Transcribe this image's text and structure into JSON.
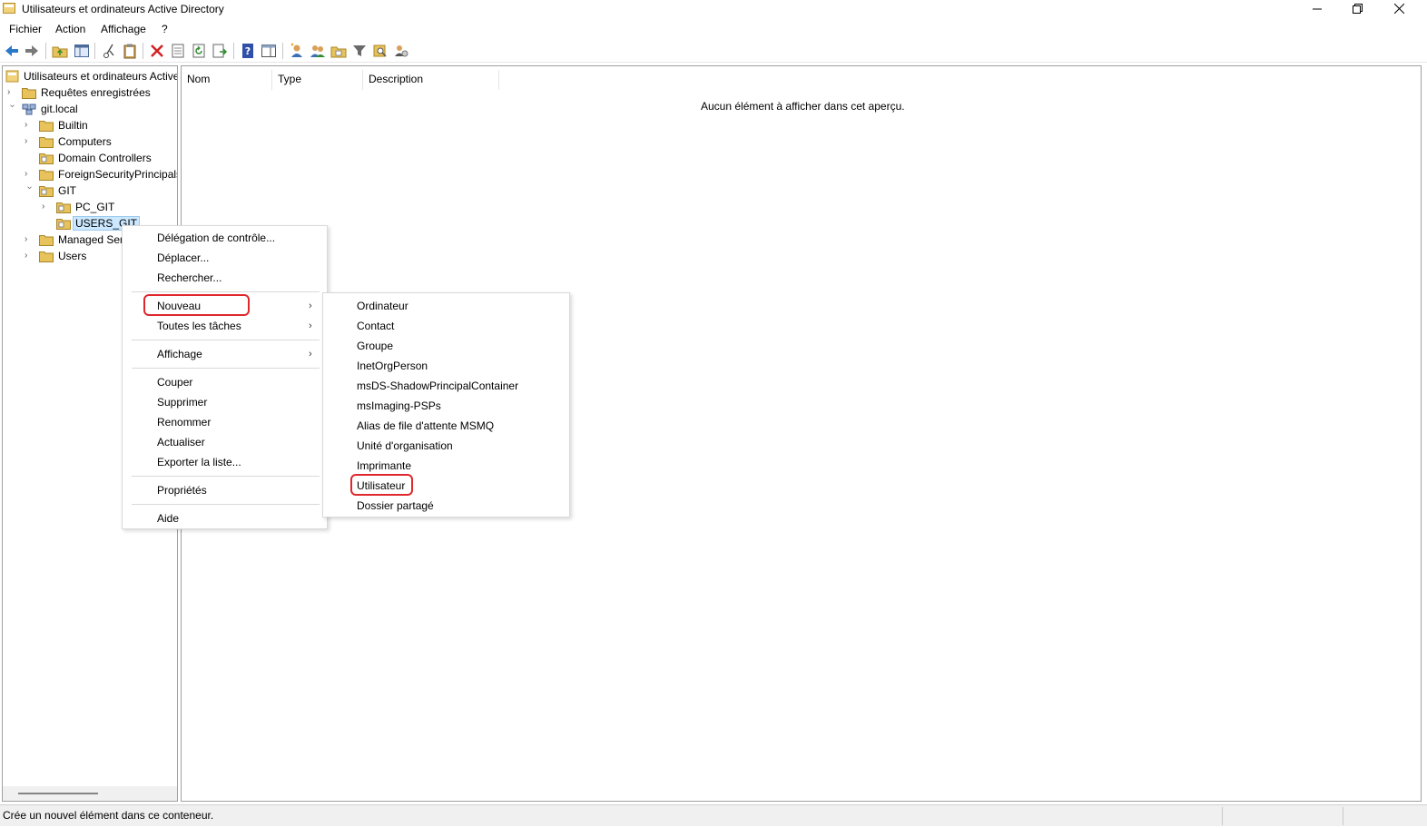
{
  "window": {
    "title": "Utilisateurs et ordinateurs Active Directory"
  },
  "menubar": {
    "items": [
      "Fichier",
      "Action",
      "Affichage",
      "?"
    ]
  },
  "tree": {
    "root": "Utilisateurs et ordinateurs Active",
    "saved_queries": "Requêtes enregistrées",
    "domain": "git.local",
    "builtin": "Builtin",
    "computers": "Computers",
    "domain_controllers": "Domain Controllers",
    "foreign": "ForeignSecurityPrincipals",
    "git": "GIT",
    "pc_git": "PC_GIT",
    "users_git": "USERS_GIT",
    "managed": "Managed Service Accounts",
    "users": "Users"
  },
  "list": {
    "columns": [
      "Nom",
      "Type",
      "Description"
    ],
    "empty_message": "Aucun élément à afficher dans cet aperçu."
  },
  "context_menu": {
    "delegation": "Délégation de contrôle...",
    "deplacer": "Déplacer...",
    "rechercher": "Rechercher...",
    "nouveau": "Nouveau",
    "toutes_taches": "Toutes les tâches",
    "affichage": "Affichage",
    "couper": "Couper",
    "supprimer": "Supprimer",
    "renommer": "Renommer",
    "actualiser": "Actualiser",
    "exporter": "Exporter la liste...",
    "proprietes": "Propriétés",
    "aide": "Aide"
  },
  "submenu": {
    "items": [
      "Ordinateur",
      "Contact",
      "Groupe",
      "InetOrgPerson",
      "msDS-ShadowPrincipalContainer",
      "msImaging-PSPs",
      "Alias de file d'attente MSMQ",
      "Unité d'organisation",
      "Imprimante",
      "Utilisateur",
      "Dossier partagé"
    ]
  },
  "statusbar": {
    "text": "Crée un nouvel élément dans ce conteneur."
  },
  "colors": {
    "highlight_outline": "#e0272c",
    "selection": "#cce8ff",
    "folder": "#e8c25a"
  }
}
